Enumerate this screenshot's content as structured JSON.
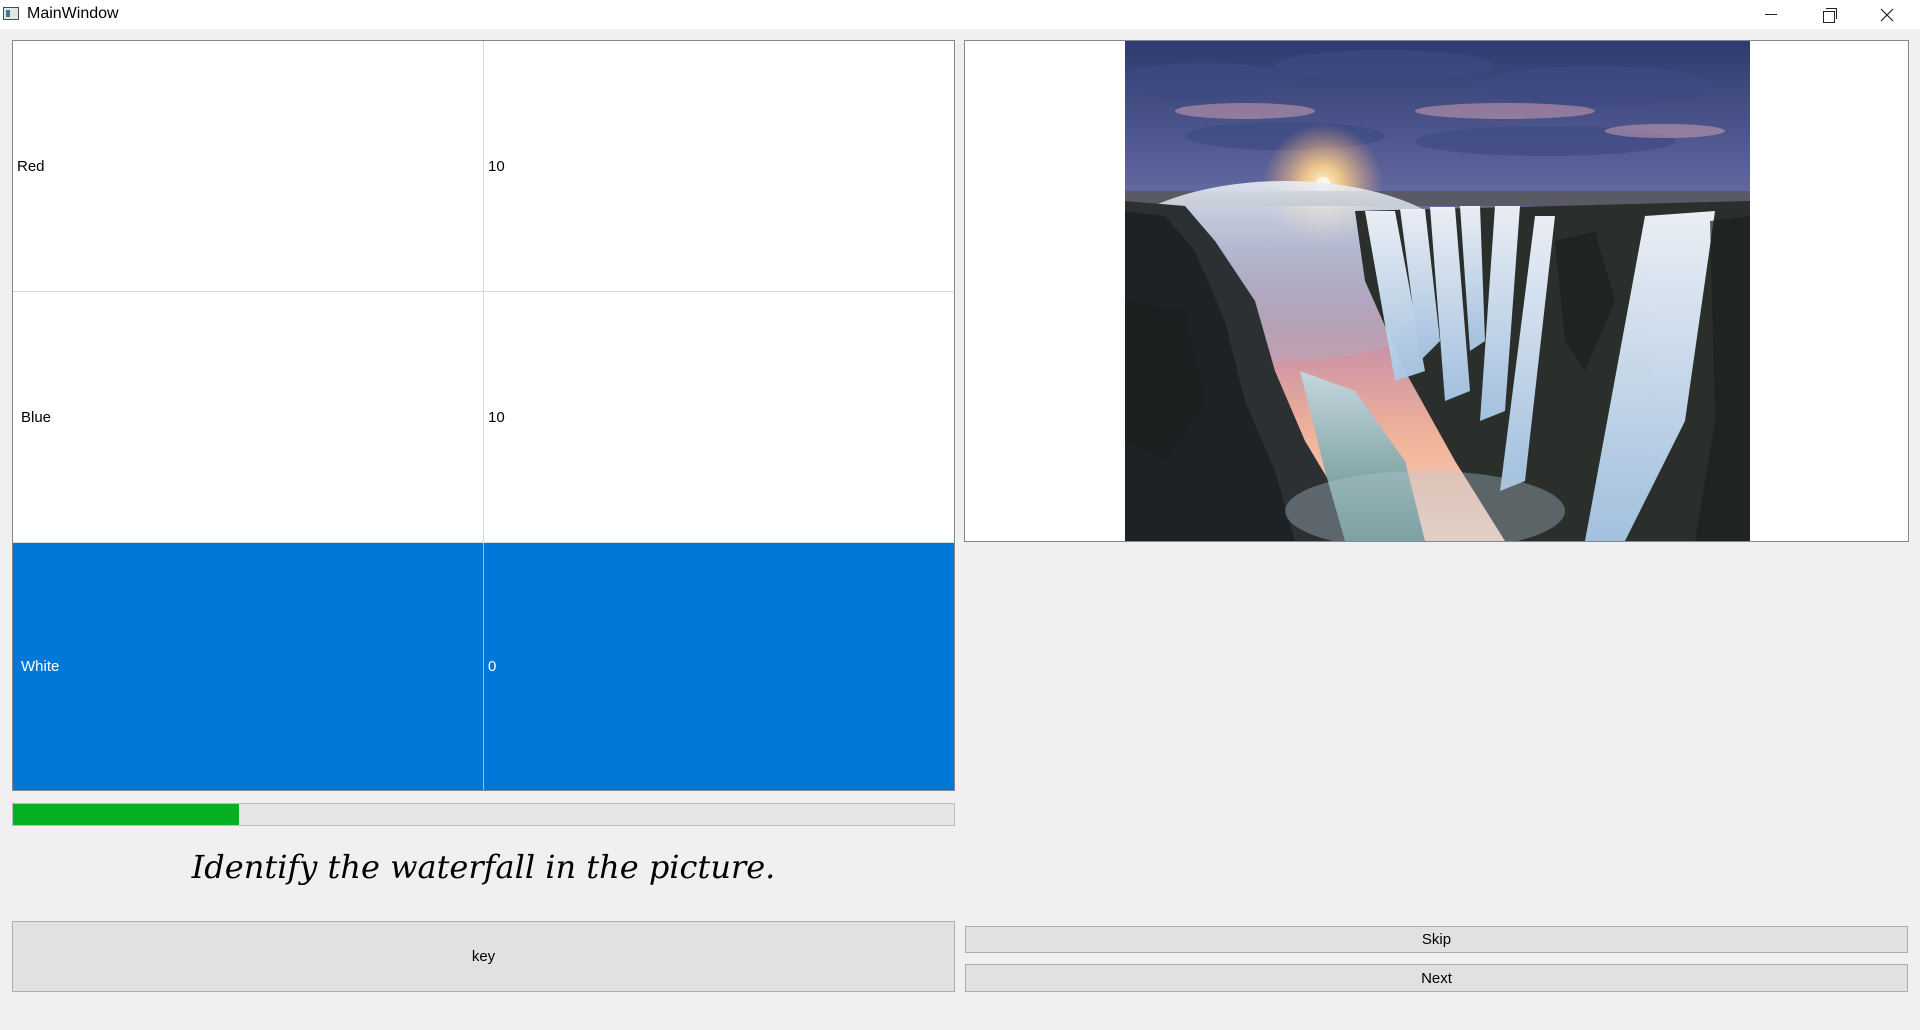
{
  "window": {
    "title": "MainWindow"
  },
  "table": {
    "rows": [
      {
        "name": "Red",
        "value": "10"
      },
      {
        "name": "Blue",
        "value": "10"
      },
      {
        "name": "White",
        "value": "0"
      }
    ],
    "selected_row": 2,
    "selection_color": "#0078d7"
  },
  "progress": {
    "value_percent": 24,
    "fill_color": "#06b025"
  },
  "question": {
    "text": "Identify the waterfall in the picture."
  },
  "buttons": {
    "key_label": "key",
    "skip_label": "Skip",
    "next_label": "Next"
  },
  "icons": {
    "app": "app-window-icon",
    "minimize": "minimize-icon",
    "maximize": "restore-icon",
    "close": "close-icon"
  }
}
